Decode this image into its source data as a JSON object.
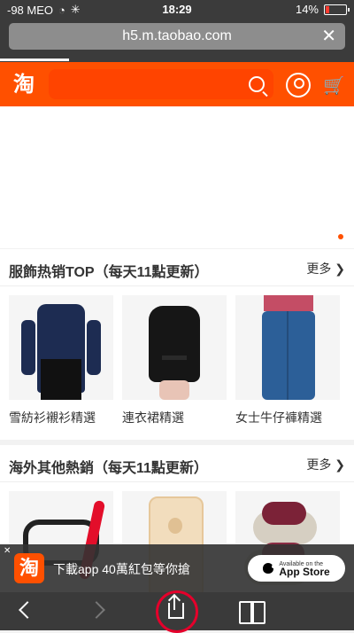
{
  "status_bar": {
    "carrier": "-98 MEO",
    "time": "18:29",
    "battery": "14%"
  },
  "browser": {
    "url": "h5.m.taobao.com",
    "clear_icon": "close-icon"
  },
  "taobao_header": {
    "logo_text": "淘",
    "icons": [
      "search-icon",
      "user-icon",
      "cart-icon"
    ]
  },
  "section_1": {
    "title": "服飾热销TOP（每天11點更新）",
    "more_label": "更多",
    "products": [
      {
        "name": "雪紡衫襯衫精選"
      },
      {
        "name": "連衣裙精選"
      },
      {
        "name": "女士牛仔褲精選"
      }
    ]
  },
  "section_2": {
    "title": "海外其他熱銷（每天11點更新）",
    "more_label": "更多"
  },
  "app_download": {
    "logo_text": "淘",
    "text": "下載app 40萬紅包等你搶",
    "store_small": "Available on the",
    "store_big": "App Store"
  },
  "colors": {
    "brand": "#ff5000",
    "share_highlight": "#e4002b"
  }
}
